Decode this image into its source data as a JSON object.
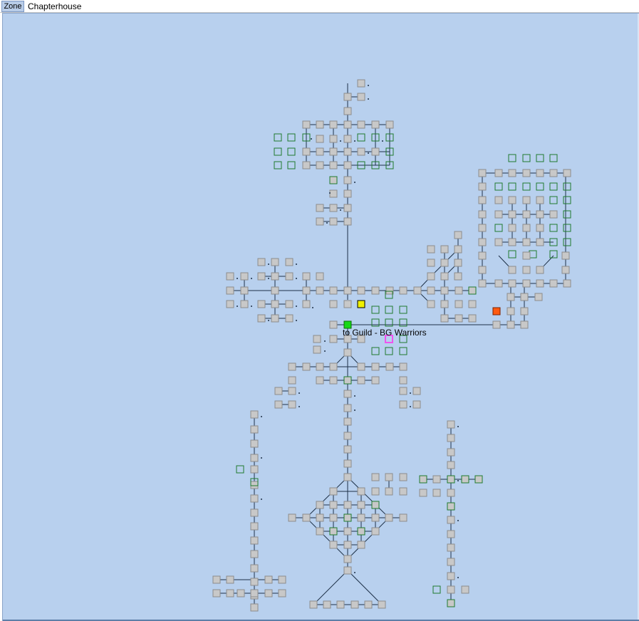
{
  "toolbar": {
    "zone_label": "Zone",
    "zone_name": "Chapterhouse"
  },
  "map": {
    "room_label": "to Guild - BG Warriors",
    "colors": {
      "background": "#b8d0ee",
      "room_fill": "#c8c8c8",
      "room_border": "#8c8c8c",
      "unexplored_border": "#1f7a2e",
      "link_line": "#1e3148",
      "current_room": "#16d816",
      "yellow_room": "#f0f000",
      "orange_room": "#ff5a10",
      "magenta_room": "#ee55ee"
    }
  }
}
